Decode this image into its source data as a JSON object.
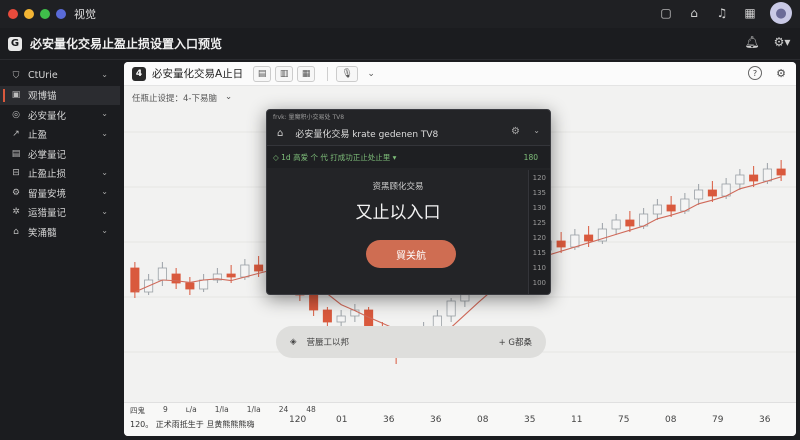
{
  "window": {
    "title": "视觉",
    "dots": [
      "#e84b3c",
      "#f3b534",
      "#3fbf4a",
      "#5a6bd8"
    ]
  },
  "app": {
    "title": "必安量化交易止盈止损设置入口预览"
  },
  "sidebar": {
    "items": [
      {
        "label": "CtUrie",
        "icon": "shield-icon",
        "chevron": true,
        "active": false
      },
      {
        "label": "观博锚",
        "icon": "image-icon",
        "chevron": false,
        "active": true
      },
      {
        "label": "必安量化",
        "icon": "coin-icon",
        "chevron": true,
        "active": false
      },
      {
        "label": "止盈",
        "icon": "chart-icon",
        "chevron": true,
        "active": false
      },
      {
        "label": "必掌量记",
        "icon": "document-icon",
        "chevron": false,
        "active": false
      },
      {
        "label": "止盈止损",
        "icon": "stoploss-icon",
        "chevron": true,
        "active": false
      },
      {
        "label": "留量安境",
        "icon": "gear-icon",
        "chevron": true,
        "active": false
      },
      {
        "label": "运猎量记",
        "icon": "settings-icon",
        "chevron": true,
        "active": false
      },
      {
        "label": "笑涌髓",
        "icon": "home-icon",
        "chevron": true,
        "active": false
      }
    ]
  },
  "toolbar": {
    "badge": "4",
    "title": "必安量化交易A止日",
    "buttons": [
      "▤",
      "▥",
      "▦"
    ],
    "mic": "🎙"
  },
  "subbar": {
    "text": "任瓶止设提：4-下易脑"
  },
  "pill": {
    "left": "营蜃工以邦",
    "right": "+ G都桑"
  },
  "modal": {
    "top": "frvk: 量魔积小交易处 TV8",
    "header": "必安量化交易 krate gedenen TV8",
    "row_text": "◇ 1d    高爱 个 代 打成功正止处止里     ▾",
    "row_value": "180",
    "subtitle": "资黑顾化交易",
    "main_text": "又止以入口",
    "button": "貿关航",
    "scale": [
      "120",
      "135",
      "130",
      "125",
      "120",
      "115",
      "110",
      "100"
    ]
  },
  "xaxis": {
    "row1": [
      "四鬼",
      "9",
      "ʟ/a",
      "1/la",
      "1/la",
      "24",
      "48"
    ],
    "ticks": [
      "120",
      "01",
      "36",
      "36",
      "08",
      "35",
      "11",
      "75",
      "08",
      "79",
      "36"
    ],
    "row2": "120。  正术雨抵生于 旦黄熊熊熊嗨"
  },
  "chart_data": {
    "type": "candlestick",
    "up_color": "#9aa0a6",
    "down_color": "#d9593d",
    "ma_color": "#d06a5a",
    "candles": [
      {
        "o": 108,
        "c": 100,
        "h": 110,
        "l": 98
      },
      {
        "o": 100,
        "c": 104,
        "h": 106,
        "l": 99
      },
      {
        "o": 104,
        "c": 108,
        "h": 110,
        "l": 102
      },
      {
        "o": 106,
        "c": 103,
        "h": 108,
        "l": 101
      },
      {
        "o": 103,
        "c": 101,
        "h": 105,
        "l": 99
      },
      {
        "o": 101,
        "c": 104,
        "h": 106,
        "l": 100
      },
      {
        "o": 104,
        "c": 106,
        "h": 108,
        "l": 103
      },
      {
        "o": 106,
        "c": 105,
        "h": 109,
        "l": 103
      },
      {
        "o": 105,
        "c": 109,
        "h": 111,
        "l": 104
      },
      {
        "o": 109,
        "c": 107,
        "h": 112,
        "l": 105
      },
      {
        "o": 107,
        "c": 110,
        "h": 113,
        "l": 106
      },
      {
        "o": 110,
        "c": 104,
        "h": 111,
        "l": 102
      },
      {
        "o": 104,
        "c": 99,
        "h": 105,
        "l": 97
      },
      {
        "o": 99,
        "c": 94,
        "h": 100,
        "l": 92
      },
      {
        "o": 94,
        "c": 90,
        "h": 95,
        "l": 87
      },
      {
        "o": 90,
        "c": 92,
        "h": 94,
        "l": 88
      },
      {
        "o": 92,
        "c": 94,
        "h": 96,
        "l": 90
      },
      {
        "o": 94,
        "c": 88,
        "h": 95,
        "l": 86
      },
      {
        "o": 88,
        "c": 84,
        "h": 90,
        "l": 82
      },
      {
        "o": 84,
        "c": 80,
        "h": 85,
        "l": 76
      },
      {
        "o": 80,
        "c": 84,
        "h": 86,
        "l": 78
      },
      {
        "o": 84,
        "c": 88,
        "h": 90,
        "l": 83
      },
      {
        "o": 88,
        "c": 92,
        "h": 94,
        "l": 86
      },
      {
        "o": 92,
        "c": 97,
        "h": 98,
        "l": 90
      },
      {
        "o": 97,
        "c": 101,
        "h": 103,
        "l": 95
      },
      {
        "o": 101,
        "c": 105,
        "h": 107,
        "l": 99
      },
      {
        "o": 105,
        "c": 108,
        "h": 110,
        "l": 103
      },
      {
        "o": 108,
        "c": 112,
        "h": 114,
        "l": 106
      },
      {
        "o": 112,
        "c": 110,
        "h": 115,
        "l": 108
      },
      {
        "o": 110,
        "c": 114,
        "h": 116,
        "l": 109
      },
      {
        "o": 114,
        "c": 117,
        "h": 119,
        "l": 112
      },
      {
        "o": 117,
        "c": 115,
        "h": 120,
        "l": 113
      },
      {
        "o": 115,
        "c": 119,
        "h": 121,
        "l": 114
      },
      {
        "o": 119,
        "c": 117,
        "h": 122,
        "l": 115
      },
      {
        "o": 117,
        "c": 121,
        "h": 123,
        "l": 116
      },
      {
        "o": 121,
        "c": 124,
        "h": 126,
        "l": 119
      },
      {
        "o": 124,
        "c": 122,
        "h": 127,
        "l": 120
      },
      {
        "o": 122,
        "c": 126,
        "h": 128,
        "l": 121
      },
      {
        "o": 126,
        "c": 129,
        "h": 131,
        "l": 124
      },
      {
        "o": 129,
        "c": 127,
        "h": 132,
        "l": 125
      },
      {
        "o": 127,
        "c": 131,
        "h": 133,
        "l": 126
      },
      {
        "o": 131,
        "c": 134,
        "h": 136,
        "l": 129
      },
      {
        "o": 134,
        "c": 132,
        "h": 137,
        "l": 130
      },
      {
        "o": 132,
        "c": 136,
        "h": 138,
        "l": 131
      },
      {
        "o": 136,
        "c": 139,
        "h": 141,
        "l": 134
      },
      {
        "o": 139,
        "c": 137,
        "h": 142,
        "l": 135
      },
      {
        "o": 137,
        "c": 141,
        "h": 143,
        "l": 136
      },
      {
        "o": 141,
        "c": 139,
        "h": 144,
        "l": 137
      }
    ],
    "ylim": [
      70,
      150
    ]
  }
}
